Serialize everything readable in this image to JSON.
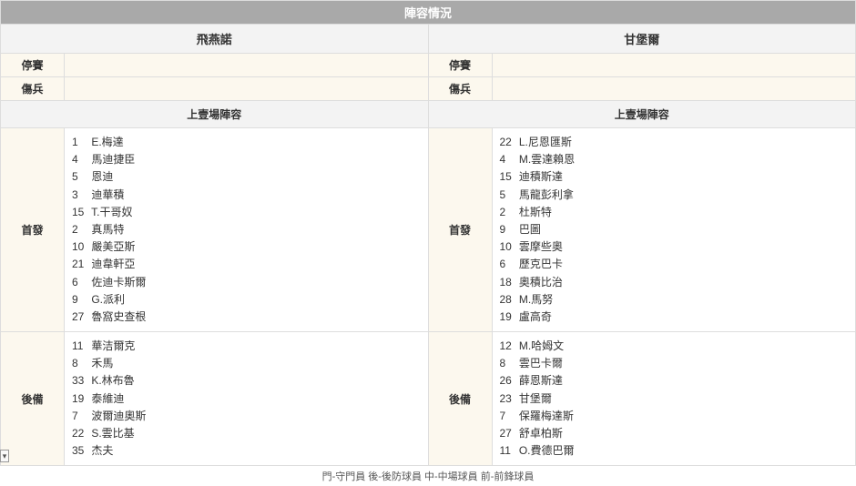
{
  "title": "陣容情況",
  "teams": {
    "left": "飛燕諾",
    "right": "甘堡爾"
  },
  "rowLabels": {
    "suspended": "停賽",
    "injured": "傷兵",
    "lastLineup": "上壹場陣容",
    "starting": "首發",
    "subs": "後備"
  },
  "left": {
    "suspended": "",
    "injured": "",
    "starting": [
      {
        "n": "1",
        "name": "E.梅達"
      },
      {
        "n": "4",
        "name": "馬迪捷臣"
      },
      {
        "n": "5",
        "name": "恩迪"
      },
      {
        "n": "3",
        "name": "迪華積"
      },
      {
        "n": "15",
        "name": "T.干哥奴"
      },
      {
        "n": "2",
        "name": "真馬特"
      },
      {
        "n": "10",
        "name": "嚴美亞斯"
      },
      {
        "n": "21",
        "name": "迪韋軒亞"
      },
      {
        "n": "6",
        "name": "佐迪卡斯爾"
      },
      {
        "n": "9",
        "name": "G.派利"
      },
      {
        "n": "27",
        "name": "魯窩史查根"
      }
    ],
    "subs": [
      {
        "n": "11",
        "name": "華洁爾克"
      },
      {
        "n": "8",
        "name": "禾馬"
      },
      {
        "n": "33",
        "name": "K.林布魯"
      },
      {
        "n": "19",
        "name": "泰維迪"
      },
      {
        "n": "7",
        "name": "波爾迪奧斯"
      },
      {
        "n": "22",
        "name": "S.雲比基"
      },
      {
        "n": "35",
        "name": "杰夫"
      }
    ]
  },
  "right": {
    "suspended": "",
    "injured": "",
    "starting": [
      {
        "n": "22",
        "name": "L.尼恩匯斯"
      },
      {
        "n": "4",
        "name": "M.雲達賴恩"
      },
      {
        "n": "15",
        "name": "迪積斯達"
      },
      {
        "n": "5",
        "name": "馬龍彭利拿"
      },
      {
        "n": "2",
        "name": "杜斯特"
      },
      {
        "n": "9",
        "name": "巴圖"
      },
      {
        "n": "10",
        "name": "雲摩些奧"
      },
      {
        "n": "6",
        "name": "歷克巴卡"
      },
      {
        "n": "18",
        "name": "奧積比治"
      },
      {
        "n": "28",
        "name": "M.馬努"
      },
      {
        "n": "19",
        "name": "盧高奇"
      }
    ],
    "subs": [
      {
        "n": "12",
        "name": "M.哈姆文"
      },
      {
        "n": "8",
        "name": "雲巴卡爾"
      },
      {
        "n": "26",
        "name": "薛恩斯達"
      },
      {
        "n": "23",
        "name": "甘堡爾"
      },
      {
        "n": "7",
        "name": "保羅梅達斯"
      },
      {
        "n": "27",
        "name": "舒卓柏斯"
      },
      {
        "n": "11",
        "name": "O.費德巴爾"
      }
    ]
  },
  "footer": "門-守門員 後-後防球員 中-中場球員 前-前鋒球員"
}
